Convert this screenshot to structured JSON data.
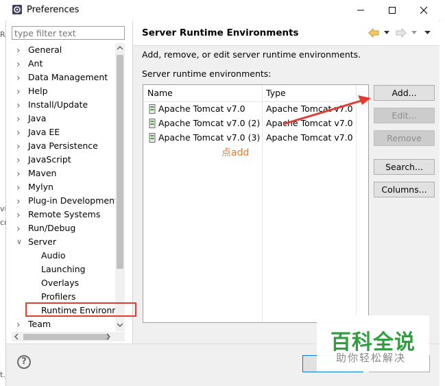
{
  "window": {
    "title": "Preferences"
  },
  "filter": {
    "placeholder": "type filter text"
  },
  "tree": {
    "items": [
      "General",
      "Ant",
      "Data Management",
      "Help",
      "Install/Update",
      "Java",
      "Java EE",
      "Java Persistence",
      "JavaScript",
      "Maven",
      "Mylyn",
      "Plug-in Development",
      "Remote Systems",
      "Run/Debug",
      "Server",
      "Team"
    ],
    "server_children": [
      "Audio",
      "Launching",
      "Overlays",
      "Profilers",
      "Runtime Environm"
    ]
  },
  "page": {
    "title": "Server Runtime Environments",
    "description": "Add, remove, or edit server runtime environments.",
    "list_label": "Server runtime environments:",
    "columns": [
      "Name",
      "Type"
    ],
    "rows": [
      {
        "name": "Apache Tomcat v7.0",
        "type": "Apache Tomcat v7.0"
      },
      {
        "name": "Apache Tomcat v7.0 (2)",
        "type": "Apache Tomcat v7.0"
      },
      {
        "name": "Apache Tomcat v7.0 (3)",
        "type": "Apache Tomcat v7.0"
      }
    ]
  },
  "buttons": {
    "add": "Add...",
    "edit": "Edit...",
    "remove": "Remove",
    "search": "Search...",
    "columns": "Columns..."
  },
  "annotation": {
    "text": "点add",
    "color": "#e8772e",
    "arrow_color": "#e03c31",
    "highlight_color": "#e03c31"
  },
  "watermark": {
    "main": "百科全说",
    "sub": "助你轻松解决"
  },
  "background_fragments": [
    "Ro",
    "vi",
    "cri",
    "t.j"
  ],
  "icons": {
    "app": "preferences-gear-icon",
    "row": "server-runtime-icon",
    "help": "help-icon"
  }
}
